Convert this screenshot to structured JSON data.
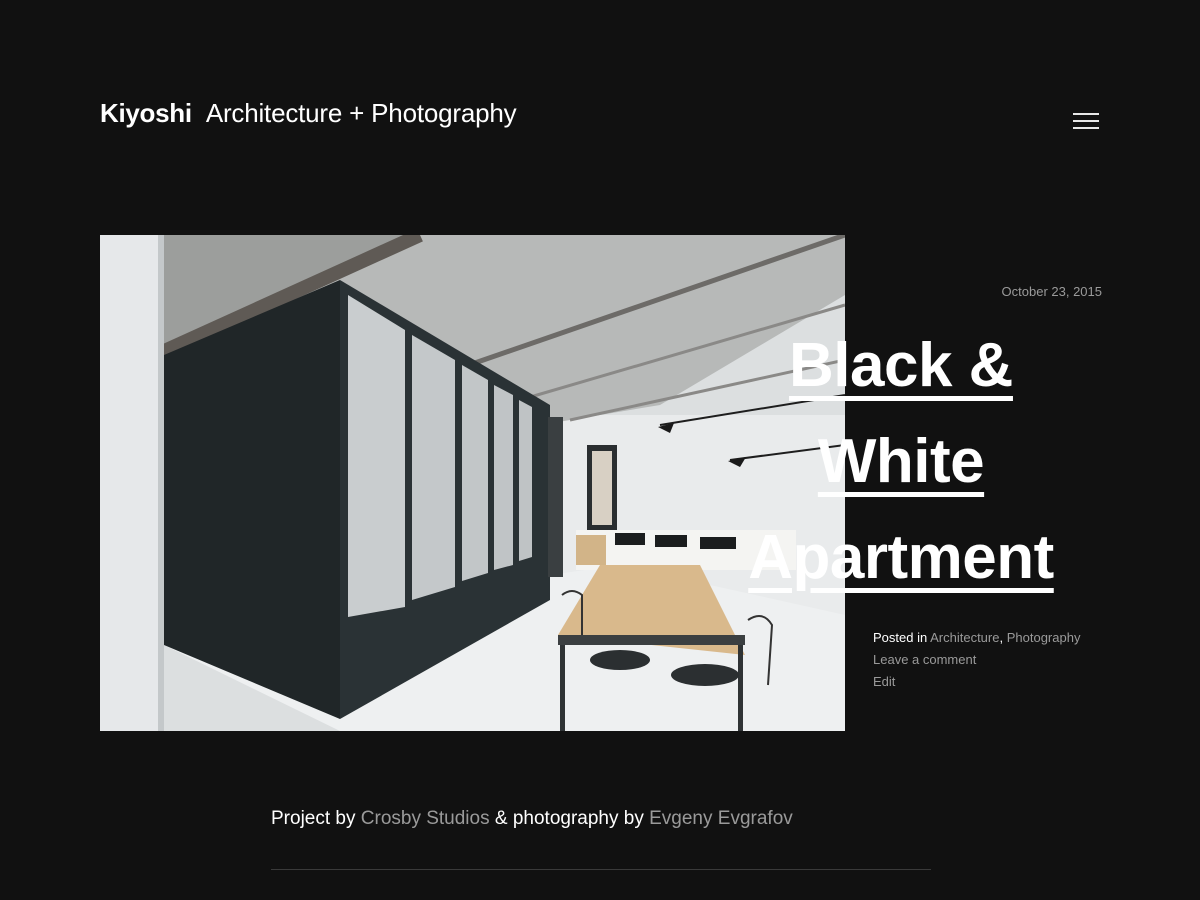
{
  "site": {
    "title": "Kiyoshi",
    "description": "Architecture + Photography"
  },
  "menu": {
    "icon": "hamburger-menu-icon"
  },
  "post": {
    "date": "October 23, 2015",
    "title": "Black & White Apartment",
    "meta": {
      "posted_in_label": "Posted in",
      "categories": [
        "Architecture",
        "Photography"
      ],
      "separator": ",",
      "comment_link": "Leave a comment",
      "edit_link": "Edit"
    },
    "content": {
      "prefix": "Project by",
      "studio": "Crosby Studios",
      "middle": "& photography by",
      "photographer": "Evgeny Evgrafov"
    }
  },
  "colors": {
    "background": "#111111",
    "text": "#ffffff",
    "muted_link": "#9a9a9a",
    "divider": "#3a3a3a"
  }
}
